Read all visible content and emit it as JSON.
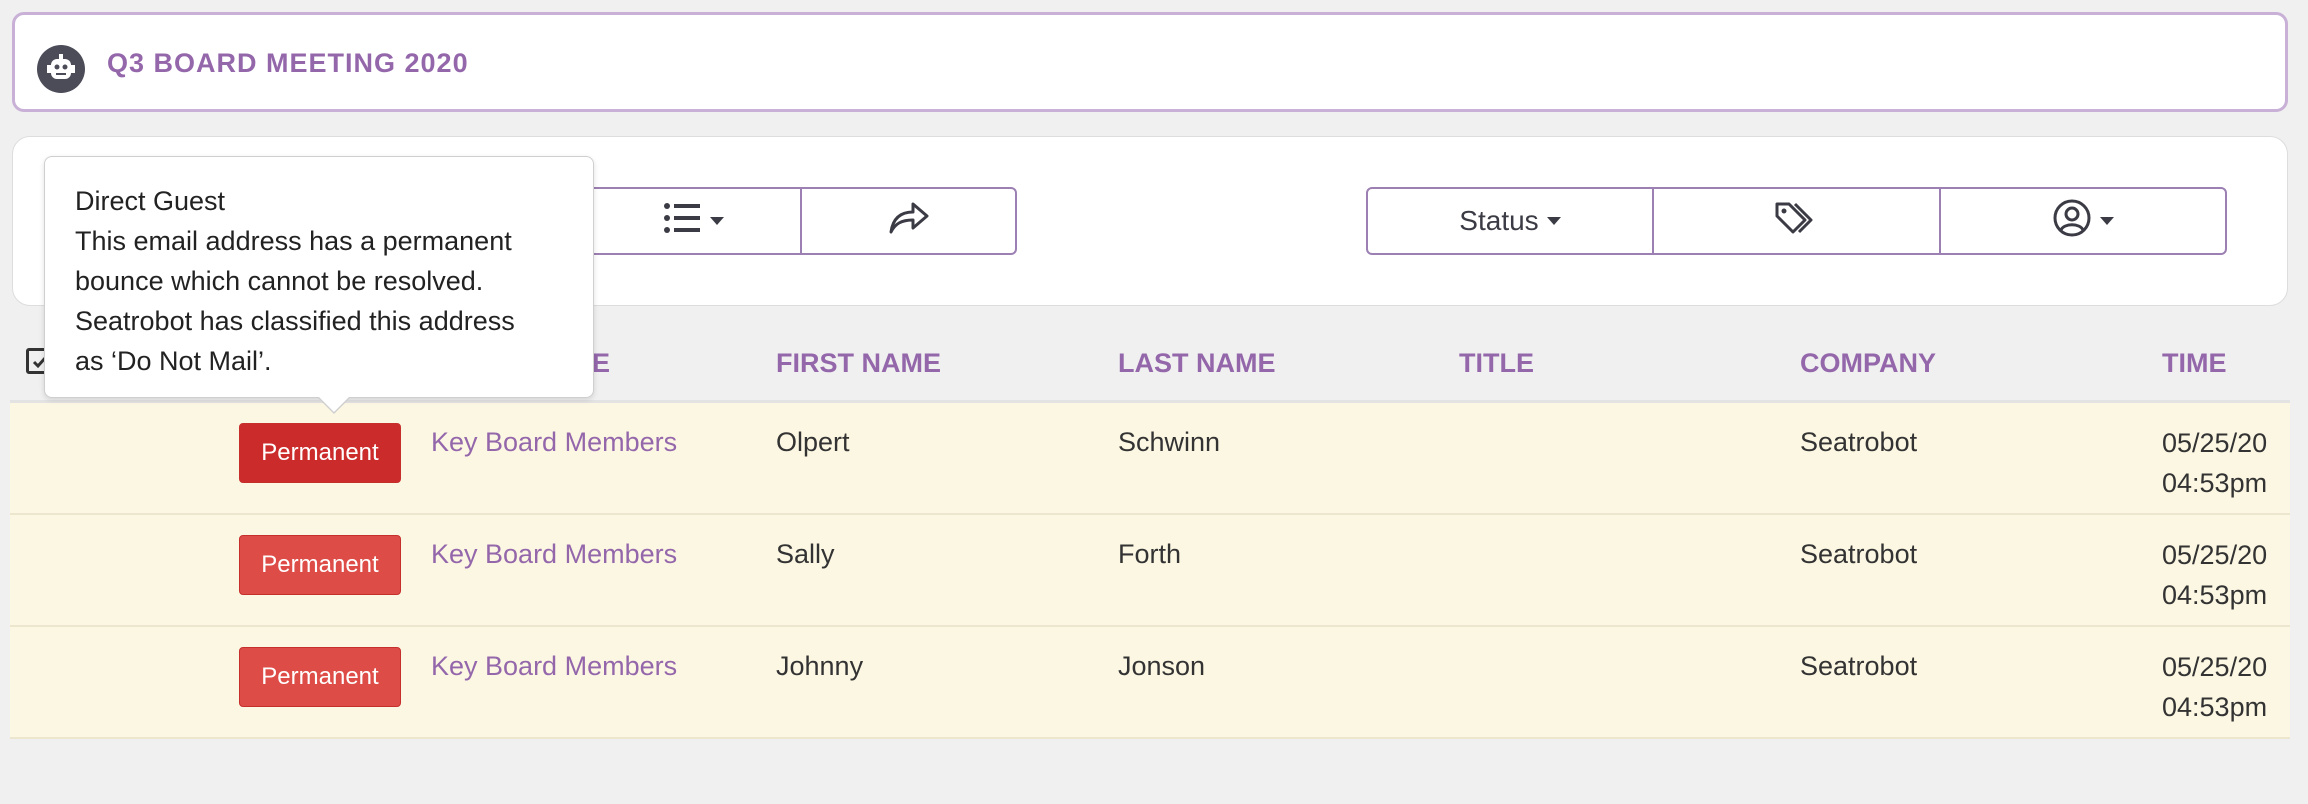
{
  "header": {
    "title": "Q3 BOARD MEETING 2020",
    "logo_icon": "robot-logo-icon"
  },
  "toolbar": {
    "attach_icon": "paperclip-icon",
    "list_icon": "list-icon",
    "share_icon": "share-icon",
    "status_label": "Status",
    "tag_icon": "tags-icon",
    "user_icon": "user-circle-icon"
  },
  "table": {
    "columns": [
      "E",
      "FIRST NAME",
      "LAST NAME",
      "TITLE",
      "COMPANY",
      "TIME"
    ],
    "rows": [
      {
        "badge": "Permanent",
        "list": "Key Board Members",
        "first": "Olpert",
        "last": "Schwinn",
        "title": "",
        "company": "Seatrobot",
        "date": "05/25/20",
        "time": "04:53pm"
      },
      {
        "badge": "Permanent",
        "list": "Key Board Members",
        "first": "Sally",
        "last": "Forth",
        "title": "",
        "company": "Seatrobot",
        "date": "05/25/20",
        "time": "04:53pm"
      },
      {
        "badge": "Permanent",
        "list": "Key Board Members",
        "first": "Johnny",
        "last": "Jonson",
        "title": "",
        "company": "Seatrobot",
        "date": "05/25/20",
        "time": "04:53pm"
      }
    ]
  },
  "tooltip": {
    "line1": "Direct Guest",
    "line2": "This email address has a permanent",
    "line3": "bounce which cannot be resolved.",
    "line4": "Seatrobot has classified this address",
    "line5": "as ‘Do Not Mail’."
  },
  "colors": {
    "accent": "#9467ab",
    "badge_active": "#cc2b2b",
    "badge": "#de4c47",
    "row_bg": "#fcf7e3"
  }
}
